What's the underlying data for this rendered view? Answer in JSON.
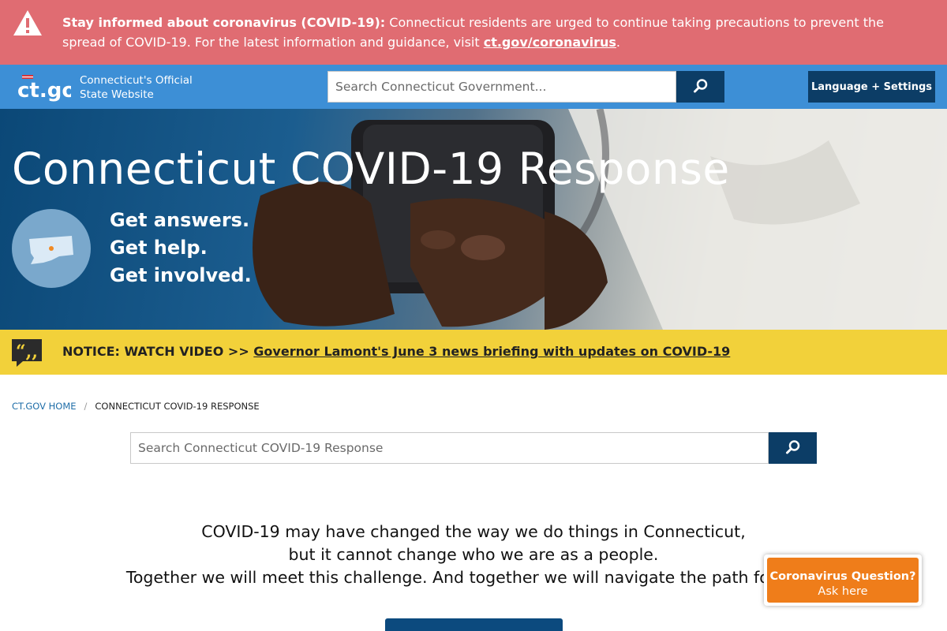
{
  "alert": {
    "title": "Stay informed about coronavirus (COVID-19):",
    "body": " Connecticut residents are urged to continue taking precautions to prevent the spread of COVID-19. For the latest information and guidance, visit ",
    "link": "ct.gov/coronavirus",
    "tail": ".",
    "icon": "warning-icon"
  },
  "header": {
    "logo_text": "ct.gov",
    "site_line1": "Connecticut's Official",
    "site_line2": "State Website",
    "search_placeholder": "Search Connecticut Government...",
    "language_button": "Language + Settings",
    "search_icon": "search-icon"
  },
  "hero": {
    "title": "Connecticut COVID-19 Response",
    "tagline": [
      "Get answers.",
      "Get help.",
      "Get involved."
    ],
    "map_icon": "connecticut-map-icon"
  },
  "notice": {
    "label": "NOTICE: WATCH VIDEO >> ",
    "link": "Governor Lamont's June 3 news briefing with updates on COVID-19",
    "icon": "quote-icon"
  },
  "breadcrumb": {
    "home": "CT.GOV HOME",
    "separator": "/",
    "current": "CONNECTICUT COVID-19 RESPONSE"
  },
  "page_search": {
    "placeholder": "Search Connecticut COVID-19 Response"
  },
  "intro": {
    "lines": [
      "COVID-19 may have changed the way we do things in Connecticut,",
      "but it cannot change who we are as a people.",
      "Together we will meet this challenge. And together we will navigate the path forward."
    ]
  },
  "chat": {
    "title": "Coronavirus Question?",
    "subtitle": "Ask here"
  },
  "colors": {
    "alert_bg": "#e06c72",
    "header_bg": "#3d8fd6",
    "dark_blue": "#0c3d66",
    "notice_bg": "#f2d13a",
    "chat_bg": "#ef7d1a"
  }
}
